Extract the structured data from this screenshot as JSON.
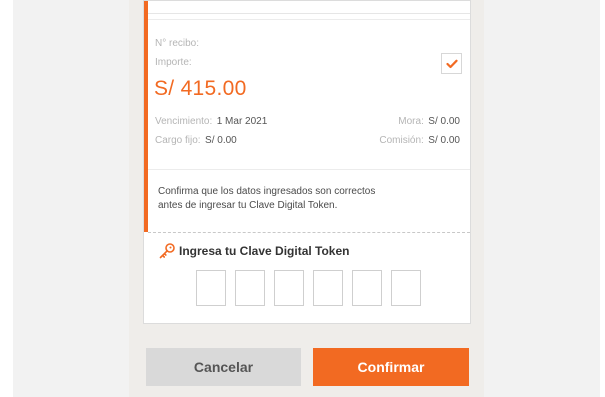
{
  "receipt": {
    "number_label": "N° recibo:",
    "amount_label": "Importe:",
    "amount": "S/ 415.00",
    "due_label": "Vencimiento:",
    "due_value": "1 Mar 2021",
    "late_label": "Mora:",
    "late_value": "S/ 0.00",
    "fixed_label": "Cargo fijo:",
    "fixed_value": "S/ 0.00",
    "commission_label": "Comisión:",
    "commission_value": "S/ 0.00",
    "selected": true
  },
  "notice": {
    "line1": "Confirma que los datos ingresados son correctos",
    "line2": "antes de ingresar tu Clave Digital Token."
  },
  "token": {
    "title": "Ingresa tu Clave Digital Token",
    "digits": [
      "",
      "",
      "",
      "",
      "",
      ""
    ]
  },
  "buttons": {
    "cancel": "Cancelar",
    "confirm": "Confirmar"
  },
  "colors": {
    "accent": "#f26a22",
    "cancel_bg": "#d9d9d9"
  },
  "icons": {
    "checkbox": "check-icon",
    "token": "key-icon"
  }
}
